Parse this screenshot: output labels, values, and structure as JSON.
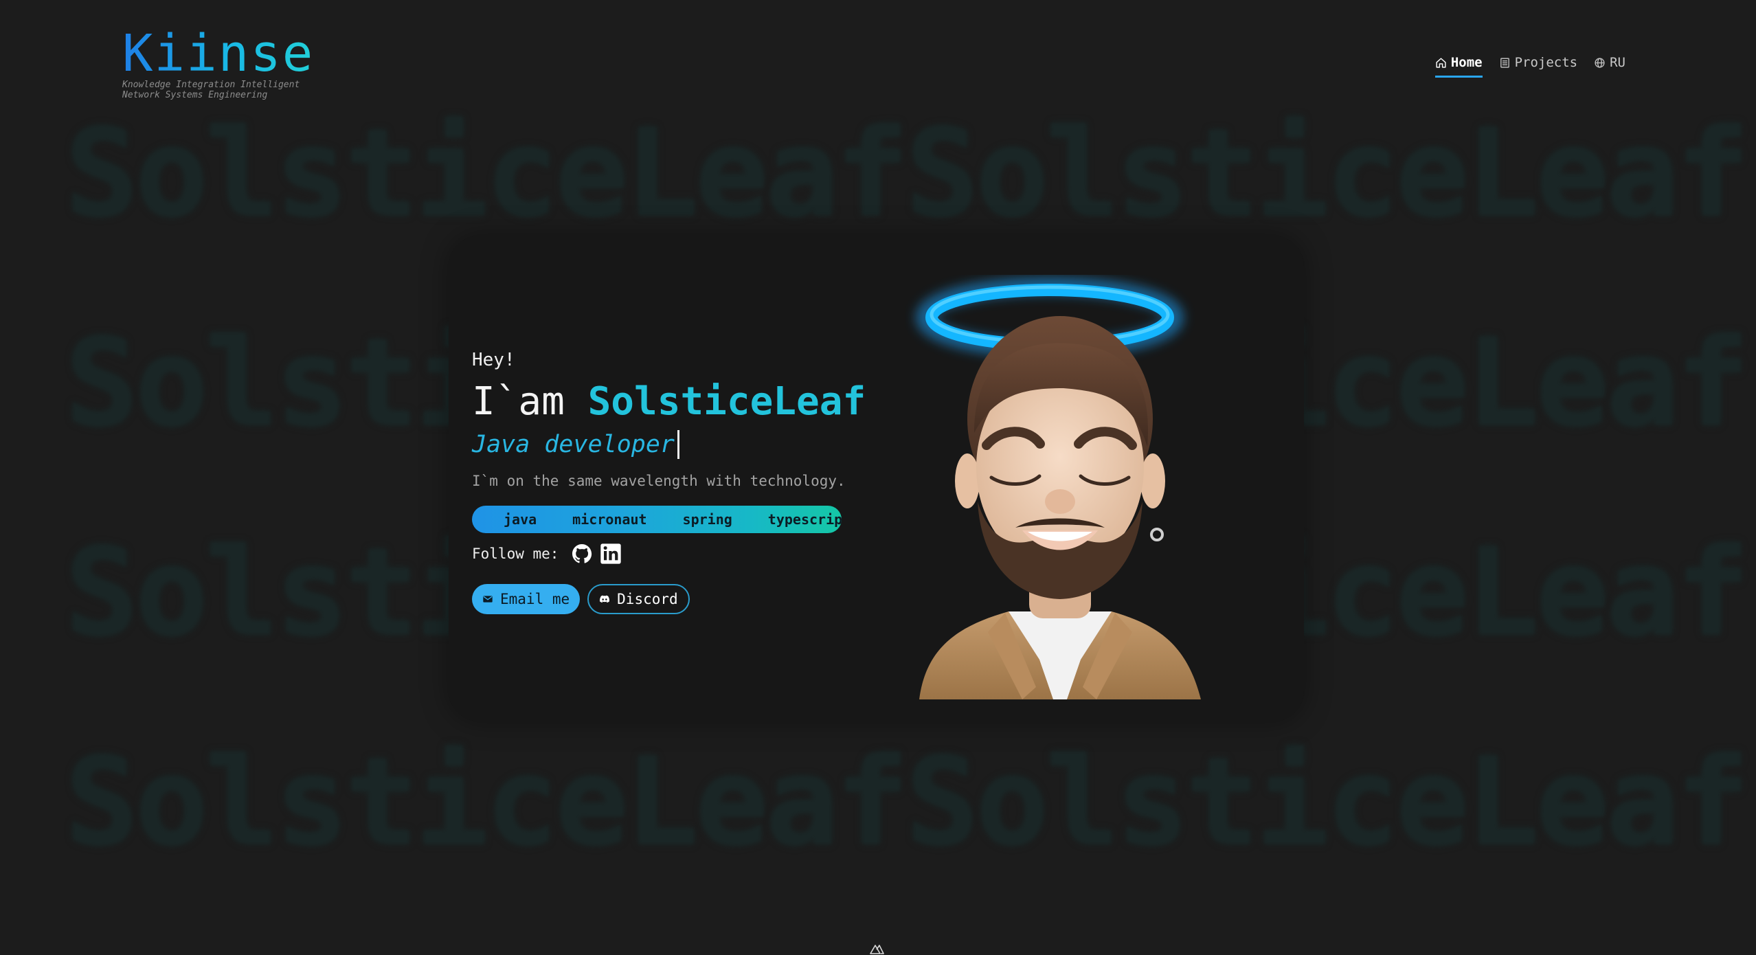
{
  "brand": {
    "title": "Kiinse",
    "subtitle": "Knowledge Integration Intelligent Network Systems Engineering"
  },
  "nav": {
    "items": [
      {
        "label": "Home",
        "icon": "home-icon",
        "active": true
      },
      {
        "label": "Projects",
        "icon": "list-icon",
        "active": false
      },
      {
        "label": "RU",
        "icon": "globe-icon",
        "active": false
      }
    ]
  },
  "watermark": {
    "text": "SolsticeLeaf"
  },
  "hero": {
    "greeting": "Hey!",
    "intro": "I`am ",
    "name": "SolsticeLeaf",
    "role": "Java developer",
    "tagline": "I`m on the same wavelength with technology.",
    "tags": [
      "java",
      "micronaut",
      "spring",
      "typescript"
    ],
    "follow_label": "Follow me:",
    "social": [
      {
        "icon": "github-icon"
      },
      {
        "icon": "linkedin-icon"
      }
    ],
    "email_button": "Email me",
    "discord_button": "Discord"
  },
  "colors": {
    "accent": "#23c3dc",
    "primary": "#35aef0",
    "background": "#1c1c1c",
    "card": "#171717"
  }
}
